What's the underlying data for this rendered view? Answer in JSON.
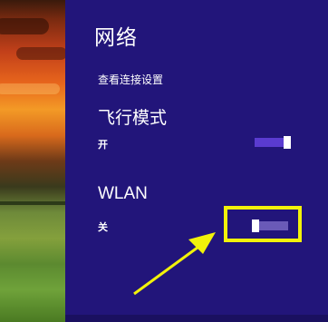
{
  "panel": {
    "title": "网络",
    "connection_settings_link": "查看连接设置"
  },
  "airplane_mode": {
    "label": "飞行模式",
    "state_text": "开",
    "is_on": true
  },
  "wlan": {
    "label": "WLAN",
    "state_text": "关",
    "is_on": false
  },
  "colors": {
    "panel_background": "#22157a",
    "toggle_on_track": "#5a3bd0",
    "toggle_off_track": "#6a5ab8",
    "highlight": "#f2f20a"
  },
  "icons": {
    "annotation": "arrow-pointer-icon"
  }
}
